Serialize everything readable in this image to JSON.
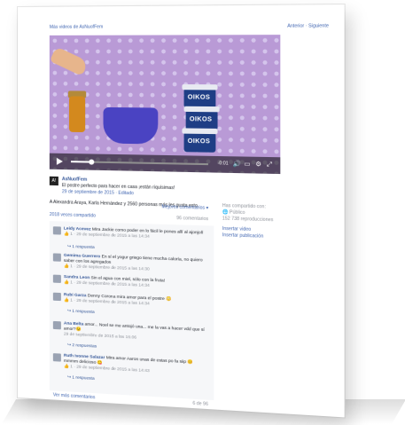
{
  "topbar": {
    "more_videos": "Más videos de AsNuofFem",
    "nav": "Anterior · Siguiente"
  },
  "video": {
    "time": "-0:01",
    "progress_fraction": 0.15,
    "cup_label": "OIKOS"
  },
  "post": {
    "page_avatar": "A!",
    "page_name": "AsNuofFem",
    "caption": "El postre perfecto para hacer en casa ¡están riquísimas!",
    "date": "29 de septiembre de 2015 · Editado",
    "likes": "A Alexandra Araya, Karla Hernández y 2560 personas más les gusta esto.",
    "relevant": "Mejores comentarios ▾",
    "shares": "2018 veces compartido",
    "comments_count": "96 comentarios"
  },
  "comments": [
    {
      "name": "Leidy Acevez",
      "text": "Mira Jackie como poder en lo fácil le pones allí al ajonjolí",
      "meta": "👍 1 · 29 de septiembre de 2015 a las 14:34",
      "reply": "↪ 1 respuesta"
    },
    {
      "name": "Gemima Guerrero",
      "text": "En sí el yogur griego tiene mucha caloría, no quiero saber con los agregados",
      "meta": "👍 1 · 29 de septiembre de 2015 a las 14:30",
      "reply": ""
    },
    {
      "name": "Sandra Leon",
      "text": "Sin el agua con miel, sólo con la fruta!",
      "meta": "👍 1 · 29 de septiembre de 2015 a las 14:34",
      "reply": ""
    },
    {
      "name": "Rubi Garza",
      "text": "Denny Corona mira amor para el postre 😳",
      "meta": "👍 1 · 29 de septiembre de 2015 a las 14:34",
      "reply": "↪ 1 respuesta"
    },
    {
      "name": "Ana Belta",
      "text": "amor... Noel se me antojó una... me la vas a hacer vdd que sí amor?😉",
      "meta": "29 de septiembre de 2015 a las 16:06",
      "reply": "↪ 2 respuestas"
    },
    {
      "name": "Ruth Ivonne Salazar",
      "text": "Mira amor Aaron unas de estas po fa siip 😊 mmmm delicioso 😋",
      "meta": "👍 1 · 29 de septiembre de 2015 a las 14:43",
      "reply": "↪ 1 respuesta"
    }
  ],
  "footer": {
    "more": "Ver más comentarios",
    "count": "6 de 96"
  },
  "side": {
    "shared_with": "Has compartido con:",
    "public": "🌐 Público",
    "views": "152 738 reproducciones",
    "insert_video": "Insertar video",
    "insert_post": "Insertar publicación"
  }
}
